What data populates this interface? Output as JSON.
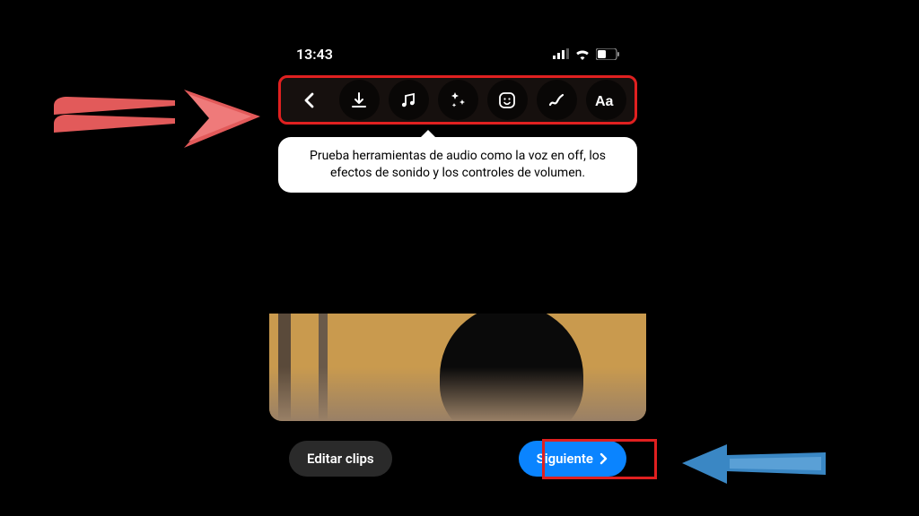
{
  "status": {
    "time": "13:43"
  },
  "toolbar": {
    "tooltip": "Prueba herramientas de audio como la voz en off, los efectos de sonido y los controles de volumen."
  },
  "actions": {
    "edit_label": "Editar clips",
    "next_label": "Siguiente"
  },
  "colors": {
    "accent_blue": "#0a84ff",
    "annotation_red": "#e02020",
    "annotation_blue": "#3a87c4"
  }
}
